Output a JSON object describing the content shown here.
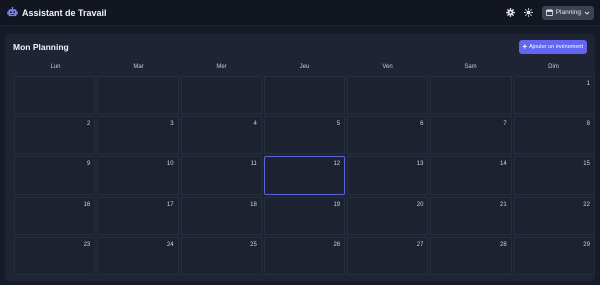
{
  "app": {
    "title": "Assistant de Travail",
    "view_label": "Planning"
  },
  "panel": {
    "title": "Mon Planning",
    "add_label": "Ajouter un événement"
  },
  "calendar": {
    "weekdays": [
      "Lun",
      "Mar",
      "Mer",
      "Jeu",
      "Ven",
      "Sam",
      "Dim"
    ],
    "weeks": [
      [
        "",
        "",
        "",
        "",
        "",
        "",
        "1"
      ],
      [
        "2",
        "3",
        "4",
        "5",
        "6",
        "7",
        "8"
      ],
      [
        "9",
        "10",
        "11",
        "12",
        "13",
        "14",
        "15"
      ],
      [
        "16",
        "17",
        "18",
        "19",
        "20",
        "21",
        "22"
      ],
      [
        "23",
        "24",
        "25",
        "26",
        "27",
        "28",
        "29"
      ]
    ],
    "today": "12"
  },
  "colors": {
    "accent": "#6366f1",
    "background": "#161b27",
    "panel": "#1e2433"
  },
  "icons": {
    "brand": "robot-icon",
    "settings": "gear-icon",
    "theme": "sun-icon",
    "view": "calendar-icon",
    "dropdown": "chevron-down-icon",
    "add": "plus-icon"
  }
}
